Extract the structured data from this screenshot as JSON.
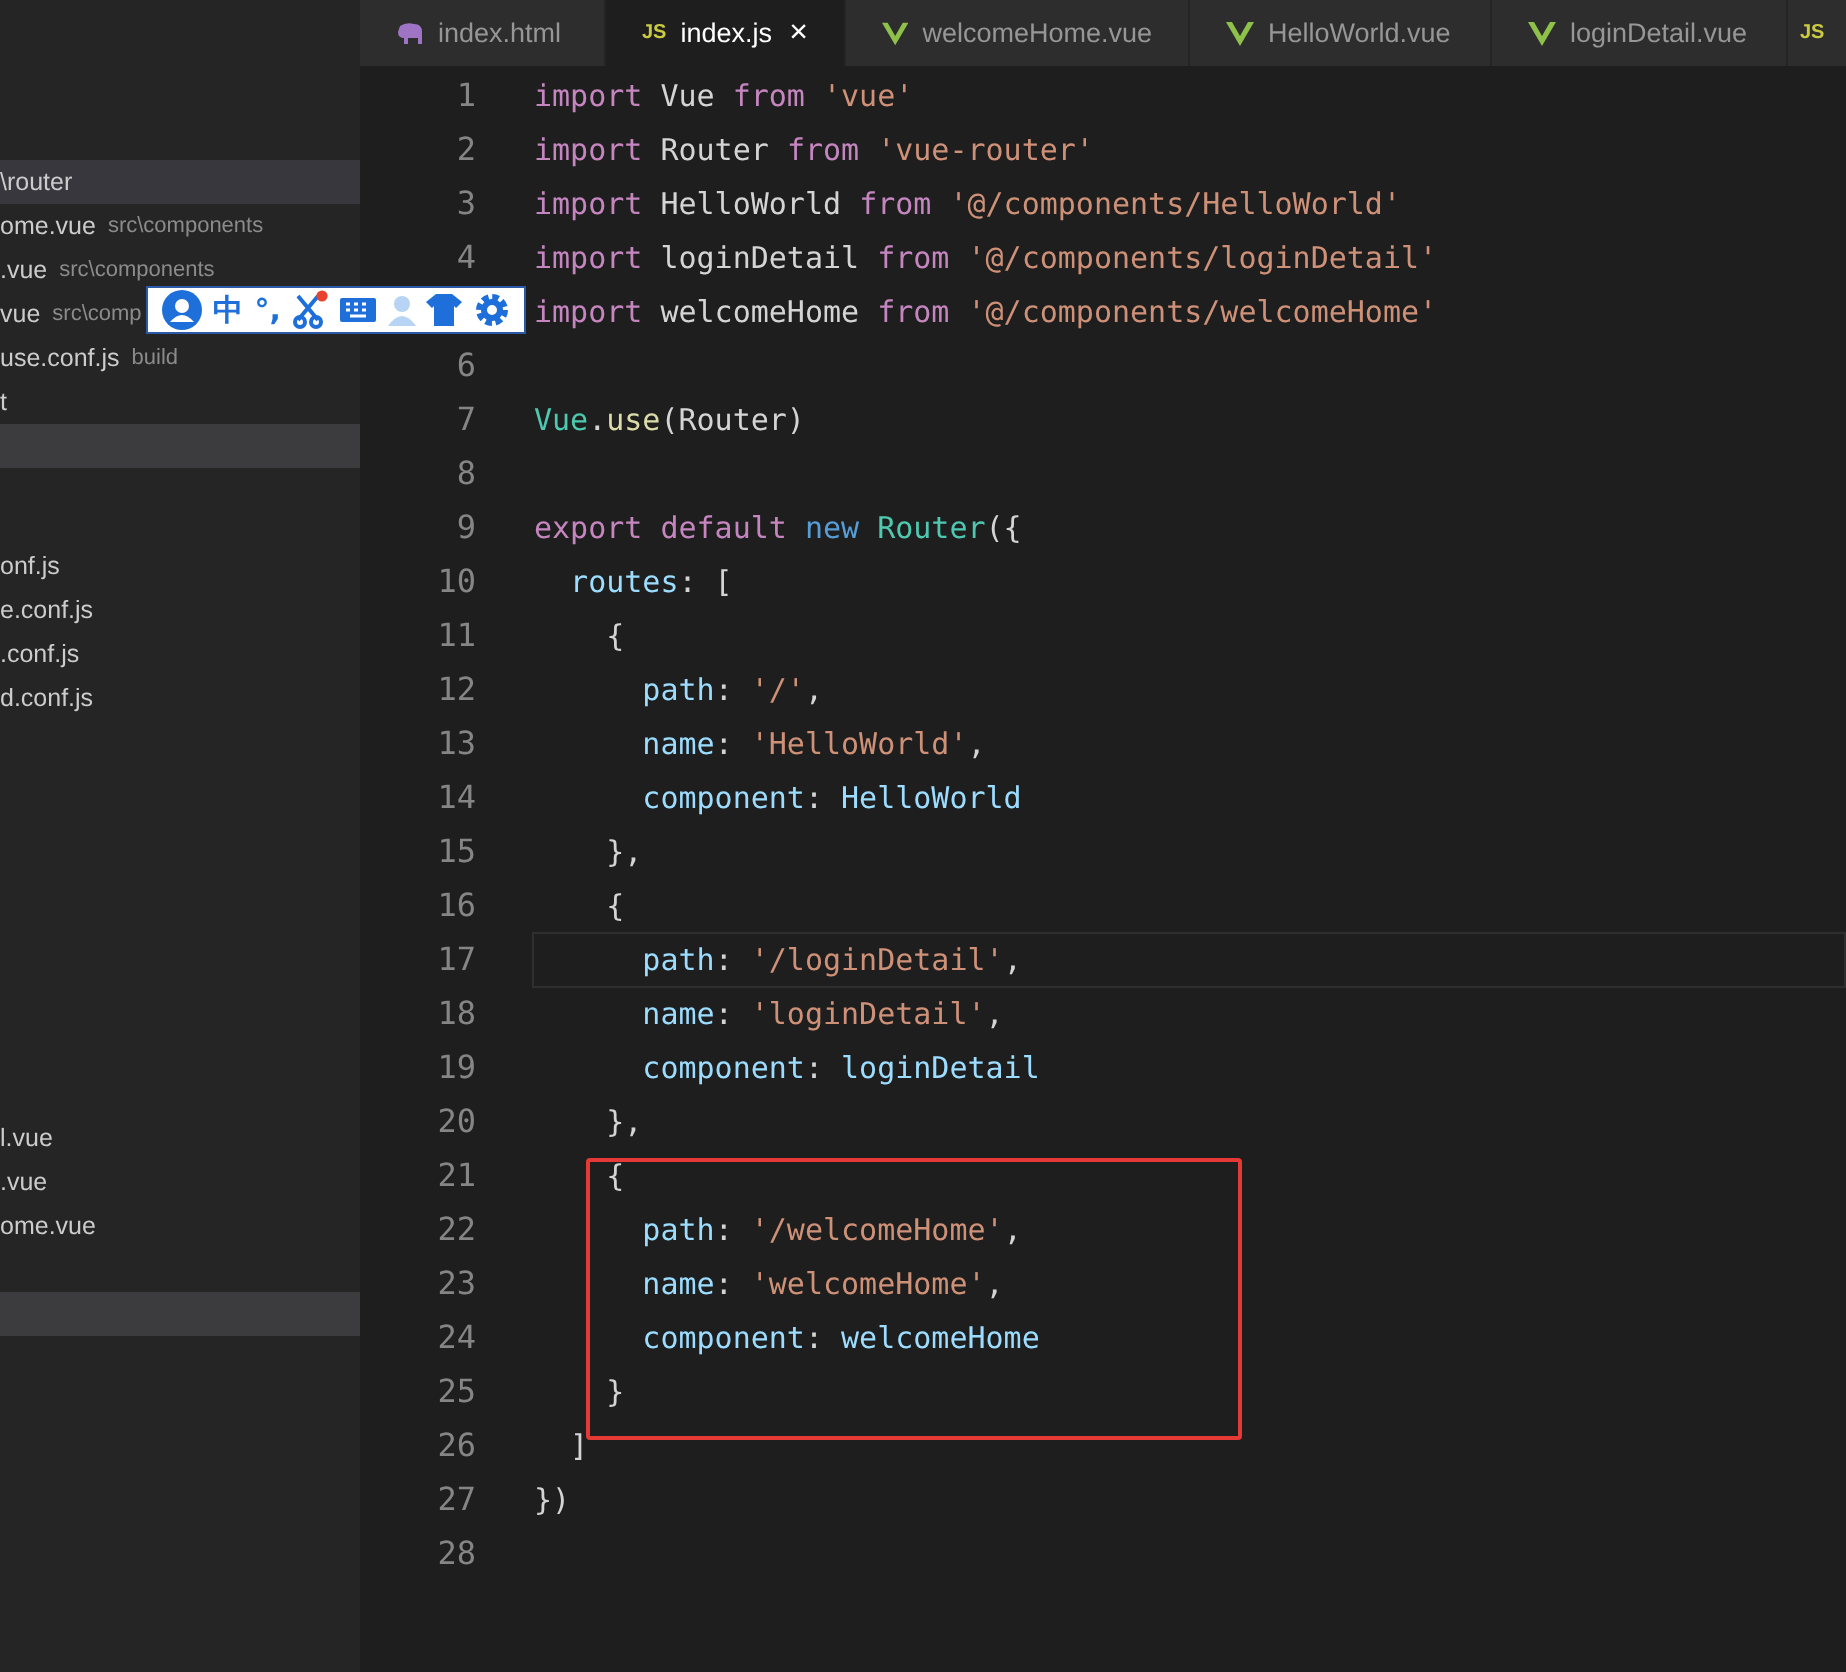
{
  "tabs": [
    {
      "kind": "html",
      "label": "index.html",
      "selected": false
    },
    {
      "kind": "js",
      "icon_text": "JS",
      "label": "index.js",
      "selected": true,
      "close": "×"
    },
    {
      "kind": "vue",
      "label": "welcomeHome.vue",
      "selected": false
    },
    {
      "kind": "vue",
      "label": "HelloWorld.vue",
      "selected": false
    },
    {
      "kind": "vue",
      "label": "loginDetail.vue",
      "selected": false
    },
    {
      "kind": "js",
      "icon_text": "JS",
      "selected": false
    }
  ],
  "sidebar": {
    "groups": [
      {
        "rows": [
          {
            "name": "\\router",
            "selected": true
          },
          {
            "name": "ome.vue",
            "path": "src\\components",
            "selected": false
          },
          {
            "name": ".vue",
            "path": "src\\components",
            "selected": false
          },
          {
            "name": "vue",
            "path": "src\\comp",
            "selected": false
          },
          {
            "name": "use.conf.js",
            "path": "build",
            "selected": false
          },
          {
            "name": "t",
            "selected": false
          }
        ]
      },
      {
        "rows": [
          {
            "name": "onf.js",
            "selected": false
          },
          {
            "name": "e.conf.js",
            "selected": false
          },
          {
            "name": ".conf.js",
            "selected": false
          },
          {
            "name": "d.conf.js",
            "selected": false
          }
        ]
      },
      {
        "rows": [
          {
            "name": "l.vue",
            "selected": false
          },
          {
            "name": ".vue",
            "selected": false
          },
          {
            "name": "ome.vue",
            "selected": false
          }
        ]
      }
    ]
  },
  "ime_toolbar": {
    "items": [
      {
        "kind": "avatar"
      },
      {
        "kind": "text",
        "text": "中"
      },
      {
        "kind": "text",
        "text": "°,"
      },
      {
        "kind": "scissors"
      },
      {
        "kind": "keyboard"
      },
      {
        "kind": "person"
      },
      {
        "kind": "shirt"
      },
      {
        "kind": "gear"
      }
    ]
  },
  "editor": {
    "lines": [
      {
        "number": "1",
        "tokens": [
          {
            "kind": "kw",
            "text": "import"
          },
          {
            "kind": "id",
            "text": " Vue "
          },
          {
            "kind": "kw",
            "text": "from"
          },
          {
            "kind": "str",
            "text": " 'vue'"
          }
        ]
      },
      {
        "number": "2",
        "tokens": [
          {
            "kind": "kw",
            "text": "import"
          },
          {
            "kind": "id",
            "text": " Router "
          },
          {
            "kind": "kw",
            "text": "from"
          },
          {
            "kind": "str",
            "text": " 'vue-router'"
          }
        ]
      },
      {
        "number": "3",
        "tokens": [
          {
            "kind": "kw",
            "text": "import"
          },
          {
            "kind": "id",
            "text": " HelloWorld "
          },
          {
            "kind": "kw",
            "text": "from"
          },
          {
            "kind": "str",
            "text": " '@/components/HelloWorld'"
          }
        ]
      },
      {
        "number": "4",
        "tokens": [
          {
            "kind": "kw",
            "text": "import"
          },
          {
            "kind": "id",
            "text": " loginDetail "
          },
          {
            "kind": "kw",
            "text": "from"
          },
          {
            "kind": "str",
            "text": " '@/components/loginDetail'"
          }
        ]
      },
      {
        "tokens": [
          {
            "kind": "kw",
            "text": "import"
          },
          {
            "kind": "id",
            "text": " welcomeHome "
          },
          {
            "kind": "kw",
            "text": "from"
          },
          {
            "kind": "str",
            "text": " '@/components/welcomeHome'"
          }
        ]
      },
      {
        "number": "6"
      },
      {
        "number": "7",
        "tokens": [
          {
            "kind": "cls",
            "text": "Vue"
          },
          {
            "kind": "punc",
            "text": "."
          },
          {
            "kind": "fn",
            "text": "use"
          },
          {
            "kind": "punc",
            "text": "(Router)"
          }
        ]
      },
      {
        "number": "8"
      },
      {
        "number": "9",
        "tokens": [
          {
            "kind": "kw",
            "text": "export default"
          },
          {
            "kind": "kw2",
            "text": " new"
          },
          {
            "kind": "cls",
            "text": " Router"
          },
          {
            "kind": "punc",
            "text": "({"
          }
        ]
      },
      {
        "number": "10",
        "tokens": [
          {
            "kind": "prop",
            "text": "  routes"
          },
          {
            "kind": "punc",
            "text": ": ["
          }
        ]
      },
      {
        "number": "11",
        "tokens": [
          {
            "kind": "punc",
            "text": "    {"
          }
        ]
      },
      {
        "number": "12",
        "tokens": [
          {
            "kind": "prop",
            "text": "      path"
          },
          {
            "kind": "punc",
            "text": ": "
          },
          {
            "kind": "str",
            "text": "'/'"
          },
          {
            "kind": "punc",
            "text": ","
          }
        ]
      },
      {
        "number": "13",
        "tokens": [
          {
            "kind": "prop",
            "text": "      name"
          },
          {
            "kind": "punc",
            "text": ": "
          },
          {
            "kind": "str",
            "text": "'HelloWorld'"
          },
          {
            "kind": "punc",
            "text": ","
          }
        ]
      },
      {
        "number": "14",
        "tokens": [
          {
            "kind": "prop",
            "text": "      component"
          },
          {
            "kind": "punc",
            "text": ": "
          },
          {
            "kind": "prop",
            "text": "HelloWorld"
          }
        ]
      },
      {
        "number": "15",
        "tokens": [
          {
            "kind": "punc",
            "text": "    },"
          }
        ]
      },
      {
        "number": "16",
        "tokens": [
          {
            "kind": "punc",
            "text": "    {"
          }
        ]
      },
      {
        "number": "17",
        "current": true,
        "tokens": [
          {
            "kind": "prop",
            "text": "      path"
          },
          {
            "kind": "punc",
            "text": ": "
          },
          {
            "kind": "str",
            "text": "'/loginDetail'"
          },
          {
            "kind": "punc",
            "text": ","
          }
        ]
      },
      {
        "number": "18",
        "tokens": [
          {
            "kind": "prop",
            "text": "      name"
          },
          {
            "kind": "punc",
            "text": ": "
          },
          {
            "kind": "str",
            "text": "'loginDetail'"
          },
          {
            "kind": "punc",
            "text": ","
          }
        ]
      },
      {
        "number": "19",
        "tokens": [
          {
            "kind": "prop",
            "text": "      component"
          },
          {
            "kind": "punc",
            "text": ": "
          },
          {
            "kind": "prop",
            "text": "loginDetail"
          }
        ]
      },
      {
        "number": "20",
        "tokens": [
          {
            "kind": "punc",
            "text": "    },"
          }
        ]
      },
      {
        "number": "21",
        "boxed": true,
        "tokens": [
          {
            "kind": "punc",
            "text": "    {"
          }
        ]
      },
      {
        "number": "22",
        "boxed": true,
        "tokens": [
          {
            "kind": "prop",
            "text": "      path"
          },
          {
            "kind": "punc",
            "text": ": "
          },
          {
            "kind": "str",
            "text": "'/welcomeHome'"
          },
          {
            "kind": "punc",
            "text": ","
          }
        ]
      },
      {
        "number": "23",
        "boxed": true,
        "tokens": [
          {
            "kind": "prop",
            "text": "      name"
          },
          {
            "kind": "punc",
            "text": ": "
          },
          {
            "kind": "str",
            "text": "'welcomeHome'"
          },
          {
            "kind": "punc",
            "text": ","
          }
        ]
      },
      {
        "number": "24",
        "boxed": true,
        "tokens": [
          {
            "kind": "prop",
            "text": "      component"
          },
          {
            "kind": "punc",
            "text": ": "
          },
          {
            "kind": "prop",
            "text": "welcomeHome"
          }
        ]
      },
      {
        "number": "25",
        "boxed": true,
        "tokens": [
          {
            "kind": "punc",
            "text": "    }"
          }
        ]
      },
      {
        "number": "26",
        "tokens": [
          {
            "kind": "punc",
            "text": "  ]"
          }
        ]
      },
      {
        "number": "27",
        "tokens": [
          {
            "kind": "punc",
            "text": "})"
          }
        ]
      },
      {
        "number": "28"
      }
    ]
  }
}
